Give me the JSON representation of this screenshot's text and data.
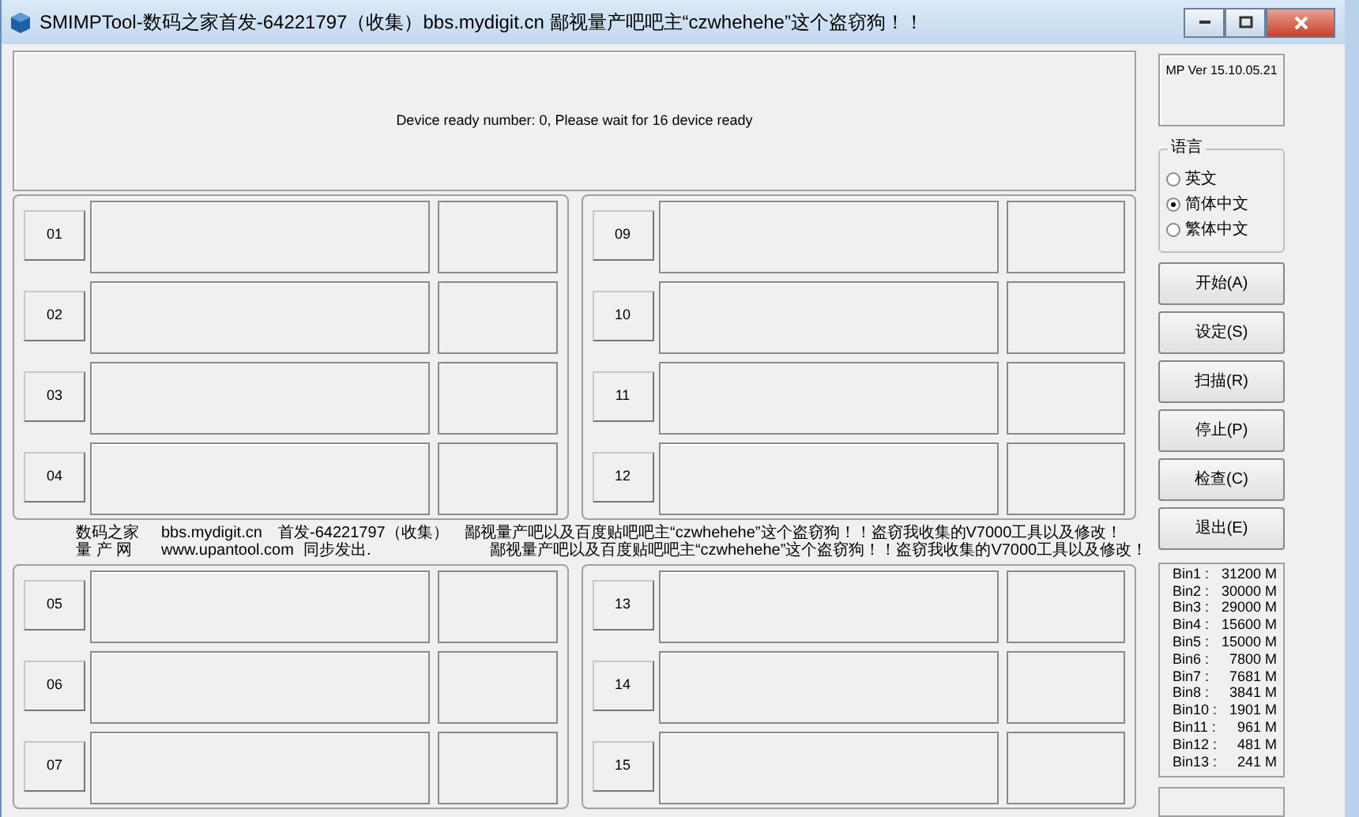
{
  "window": {
    "title": "SMIMPTool-数码之家首发-64221797（收集）bbs.mydigit.cn 鄙视量产吧吧主“czwhehehe”这个盗窃狗！！"
  },
  "status_message": "Device ready number: 0, Please wait for 16 device ready",
  "port_groups": [
    {
      "slots": [
        "01",
        "02",
        "03",
        "04"
      ]
    },
    {
      "slots": [
        "09",
        "10",
        "11",
        "12"
      ]
    }
  ],
  "notice_lines": [
    [
      "数码之家",
      "bbs.mydigit.cn",
      "首发-64221797（收集）",
      "鄙视量产吧以及百度贴吧吧主“czwhehehe”这个盗窃狗！！盗窃我收集的V7000工具以及修改！"
    ],
    [
      "量 产 网",
      "www.upantool.com",
      "同步发出.",
      "鄙视量产吧以及百度贴吧吧主“czwhehehe”这个盗窃狗！！盗窃我收集的V7000工具以及修改！"
    ]
  ],
  "port_groups_lower": [
    {
      "slots": [
        "05",
        "06",
        "07"
      ]
    },
    {
      "slots": [
        "13",
        "14",
        "15"
      ]
    }
  ],
  "version": "MP Ver 15.10.05.21",
  "language": {
    "title": "语言",
    "options": [
      {
        "label": "英文",
        "selected": false
      },
      {
        "label": "简体中文",
        "selected": true
      },
      {
        "label": "繁体中文",
        "selected": false
      }
    ]
  },
  "buttons": [
    "开始(A)",
    "设定(S)",
    "扫描(R)",
    "停止(P)",
    "检查(C)",
    "退出(E)"
  ],
  "bins": [
    {
      "name": "Bin1 :",
      "size": "31200 M"
    },
    {
      "name": "Bin2 :",
      "size": "30000 M"
    },
    {
      "name": "Bin3 :",
      "size": "29000 M"
    },
    {
      "name": "Bin4 :",
      "size": "15600 M"
    },
    {
      "name": "Bin5 :",
      "size": "15000 M"
    },
    {
      "name": "Bin6 :",
      "size": "7800 M"
    },
    {
      "name": "Bin7 :",
      "size": "7681 M"
    },
    {
      "name": "Bin8 :",
      "size": "3841 M"
    },
    {
      "name": "Bin10 :",
      "size": "1901 M"
    },
    {
      "name": "Bin11 :",
      "size": "961 M"
    },
    {
      "name": "Bin12 :",
      "size": "481 M"
    },
    {
      "name": "Bin13 :",
      "size": "241 M"
    }
  ]
}
